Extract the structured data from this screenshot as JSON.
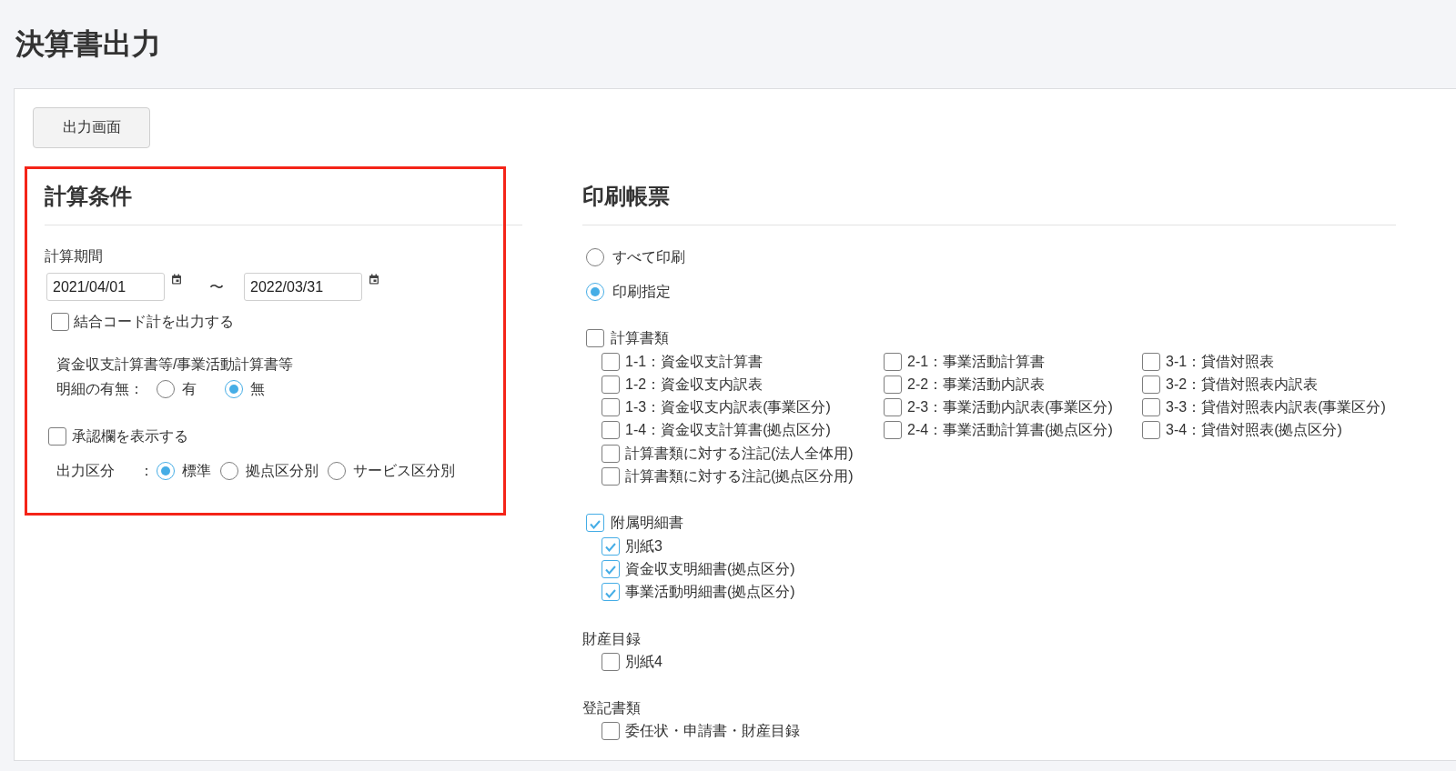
{
  "page": {
    "title": "決算書出力"
  },
  "toolbar": {
    "button": "出力画面"
  },
  "calc_conditions": {
    "heading": "計算条件",
    "highlighted": true,
    "period": {
      "label": "計算期間",
      "from": "2021/04/01",
      "separator": "〜",
      "to": "2022/03/31"
    },
    "combine_code": {
      "label": "結合コード計を出力する",
      "checked": false
    },
    "detail": {
      "title": "資金収支計算書等/事業活動計算書等",
      "label": "明細の有無：",
      "options": [
        {
          "label": "有",
          "selected": false
        },
        {
          "label": "無",
          "selected": true
        }
      ]
    },
    "approval": {
      "label": "承認欄を表示する",
      "checked": false
    },
    "output_division": {
      "label": "出力区分",
      "colon": "：",
      "options": [
        {
          "label": "標準",
          "selected": true
        },
        {
          "label": "拠点区分別",
          "selected": false
        },
        {
          "label": "サービス区分別",
          "selected": false
        }
      ]
    }
  },
  "print_forms": {
    "heading": "印刷帳票",
    "mode_options": [
      {
        "label": "すべて印刷",
        "selected": false
      },
      {
        "label": "印刷指定",
        "selected": true
      }
    ],
    "groups": [
      {
        "kind": "checkbox",
        "label": "計算書類",
        "checked": false,
        "columns": [
          [
            {
              "label": "1-1：資金収支計算書",
              "checked": false
            },
            {
              "label": "1-2：資金収支内訳表",
              "checked": false
            },
            {
              "label": "1-3：資金収支内訳表(事業区分)",
              "checked": false
            },
            {
              "label": "1-4：資金収支計算書(拠点区分)",
              "checked": false
            },
            {
              "label": "計算書類に対する注記(法人全体用)",
              "checked": false
            },
            {
              "label": "計算書類に対する注記(拠点区分用)",
              "checked": false
            }
          ],
          [
            {
              "label": "2-1：事業活動計算書",
              "checked": false
            },
            {
              "label": "2-2：事業活動内訳表",
              "checked": false
            },
            {
              "label": "2-3：事業活動内訳表(事業区分)",
              "checked": false
            },
            {
              "label": "2-4：事業活動計算書(拠点区分)",
              "checked": false
            }
          ],
          [
            {
              "label": "3-1：貸借対照表",
              "checked": false
            },
            {
              "label": "3-2：貸借対照表内訳表",
              "checked": false
            },
            {
              "label": "3-3：貸借対照表内訳表(事業区分)",
              "checked": false
            },
            {
              "label": "3-4：貸借対照表(拠点区分)",
              "checked": false
            }
          ]
        ]
      },
      {
        "kind": "checkbox",
        "label": "附属明細書",
        "checked": true,
        "columns": [
          [
            {
              "label": "別紙3",
              "checked": true
            },
            {
              "label": "資金収支明細書(拠点区分)",
              "checked": true
            },
            {
              "label": "事業活動明細書(拠点区分)",
              "checked": true
            }
          ]
        ]
      },
      {
        "kind": "heading",
        "label": "財産目録",
        "columns": [
          [
            {
              "label": "別紙4",
              "checked": false
            }
          ]
        ]
      },
      {
        "kind": "heading",
        "label": "登記書類",
        "columns": [
          [
            {
              "label": "委任状・申請書・財産目録",
              "checked": false
            }
          ]
        ]
      }
    ]
  }
}
